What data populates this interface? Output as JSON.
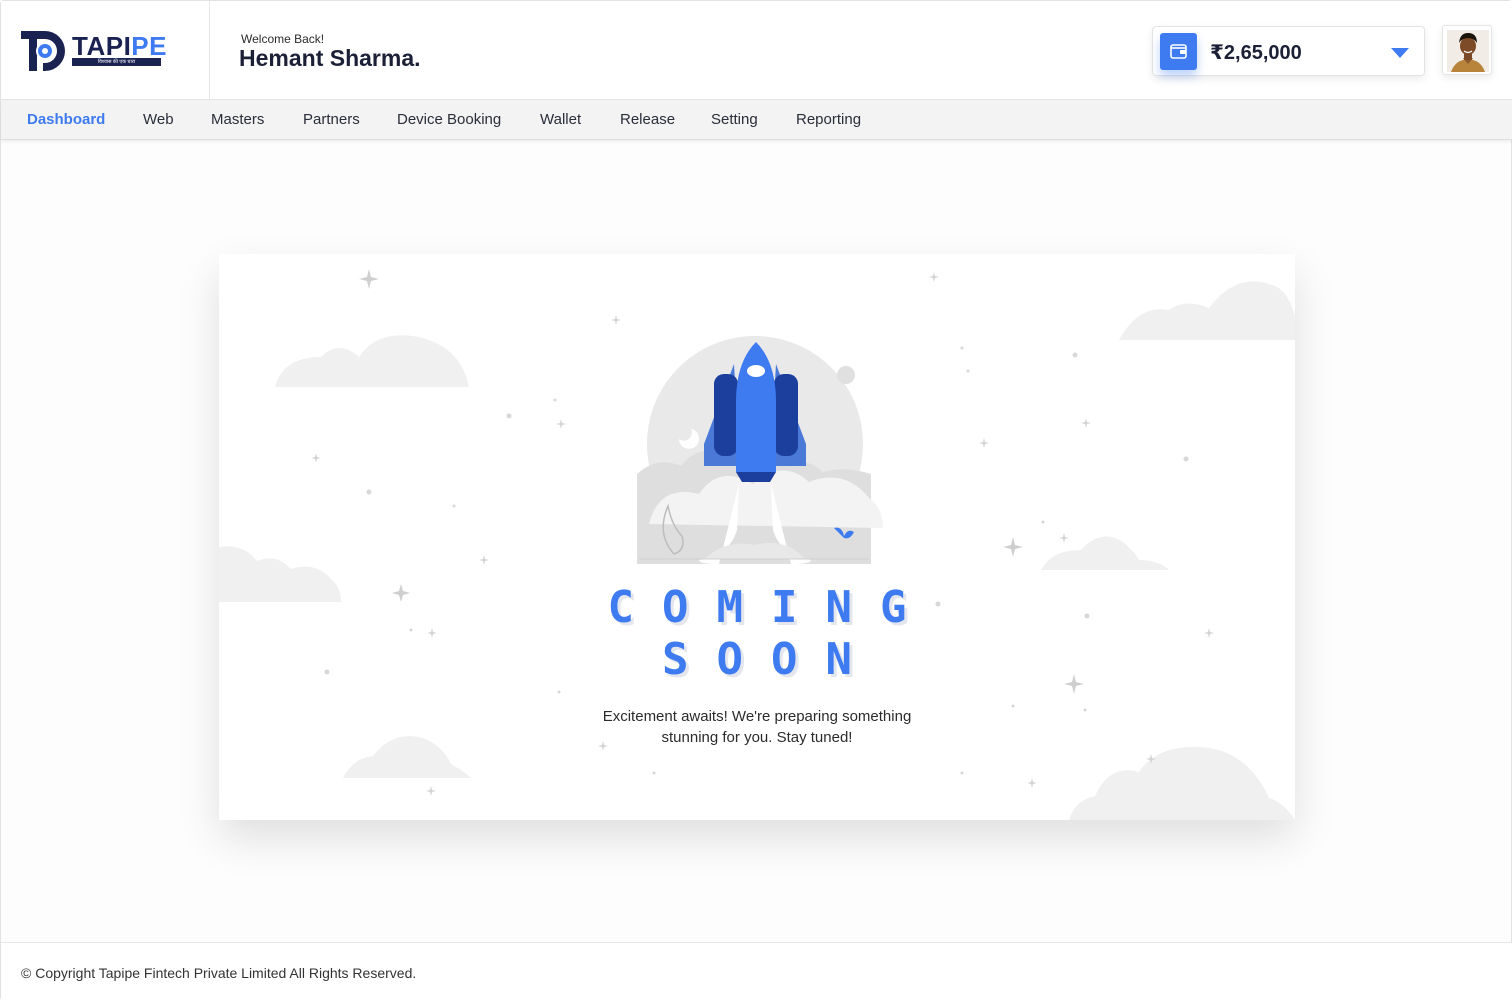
{
  "brand": {
    "name_part1": "TAPI",
    "name_part2": "PE",
    "tagline": "विश्वास की एक धारा"
  },
  "header": {
    "welcome": "Welcome Back!",
    "user_name": "Hemant Sharma."
  },
  "wallet": {
    "balance": "₹2,65,000",
    "icon": "wallet-icon"
  },
  "nav": {
    "items": [
      {
        "label": "Dashboard",
        "active": true
      },
      {
        "label": "Web"
      },
      {
        "label": "Masters"
      },
      {
        "label": "Partners"
      },
      {
        "label": "Device Booking"
      },
      {
        "label": "Wallet"
      },
      {
        "label": "Release"
      },
      {
        "label": "Setting"
      },
      {
        "label": "Reporting"
      }
    ]
  },
  "main": {
    "heading_line1": "COMING",
    "heading_line2": "SOON",
    "description": "Excitement awaits! We're preparing something stunning for you. Stay tuned!"
  },
  "footer": {
    "copyright": "© Copyright Tapipe Fintech Private Limited All Rights Reserved."
  },
  "colors": {
    "accent": "#3f7bf0",
    "brand_dark": "#1a2252"
  }
}
